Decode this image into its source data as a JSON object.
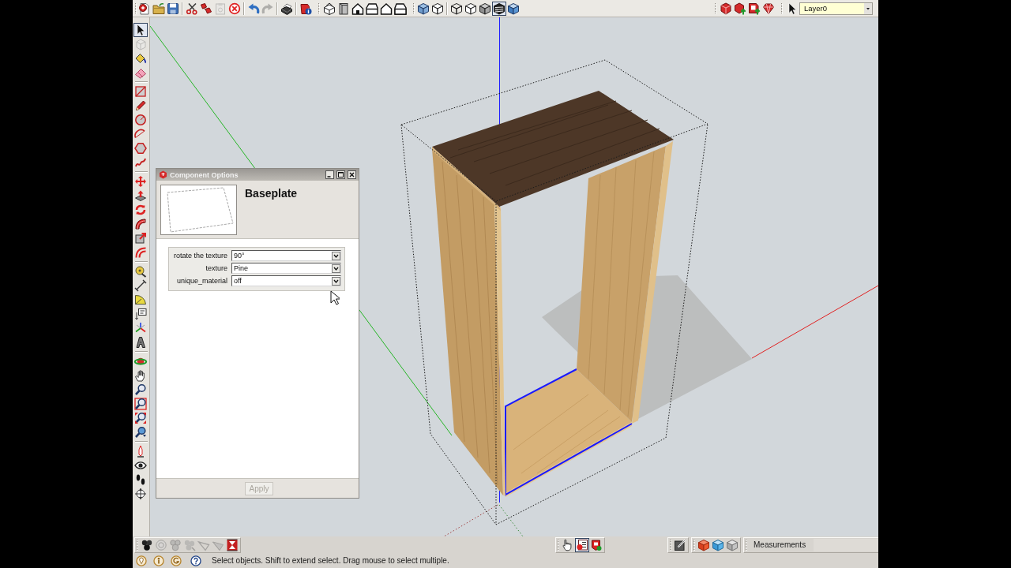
{
  "standard_toolbar": {
    "buttons": [
      {
        "disabled": false
      },
      {
        "disabled": false
      },
      {
        "disabled": false
      },
      {
        "disabled": false
      },
      {
        "disabled": false
      },
      {
        "disabled": true
      },
      {
        "disabled": false
      },
      {
        "disabled": false
      },
      {
        "disabled": true
      },
      {
        "disabled": false
      },
      {
        "disabled": false
      }
    ]
  },
  "style_toolbar": {
    "buttons": [
      {
        "selected": false
      },
      {
        "selected": false
      },
      {
        "selected": false
      },
      {
        "selected": false
      },
      {
        "selected": false
      },
      {
        "selected": true
      },
      {
        "selected": false
      }
    ]
  },
  "layers_toolbar": {
    "current_layer": "Layer0"
  },
  "tool_palette": {
    "groups": [
      {
        "tools": [
          {
            "selected": true,
            "disabled": false
          },
          {
            "selected": false,
            "disabled": true
          },
          {
            "selected": false,
            "disabled": false
          },
          {
            "selected": false,
            "disabled": false
          }
        ]
      },
      {
        "tools": [
          {
            "selected": false,
            "disabled": false
          },
          {
            "selected": false,
            "disabled": false
          },
          {
            "selected": false,
            "disabled": false
          },
          {
            "selected": false,
            "disabled": false
          },
          {
            "selected": false,
            "disabled": false
          },
          {
            "selected": false,
            "disabled": false
          }
        ]
      },
      {
        "tools": [
          {
            "selected": false,
            "disabled": false
          },
          {
            "selected": false,
            "disabled": false
          },
          {
            "selected": false,
            "disabled": false
          },
          {
            "selected": false,
            "disabled": false
          },
          {
            "selected": false,
            "disabled": false
          },
          {
            "selected": false,
            "disabled": false
          }
        ]
      },
      {
        "tools": [
          {
            "selected": false,
            "disabled": false
          },
          {
            "selected": false,
            "disabled": false
          },
          {
            "selected": false,
            "disabled": false
          },
          {
            "selected": false,
            "disabled": false
          },
          {
            "selected": false,
            "disabled": false
          },
          {
            "selected": false,
            "disabled": false
          }
        ]
      },
      {
        "tools": [
          {
            "selected": false,
            "disabled": false
          },
          {
            "selected": false,
            "disabled": false
          },
          {
            "selected": false,
            "disabled": false
          },
          {
            "selected": false,
            "disabled": false
          },
          {
            "selected": false,
            "disabled": false
          },
          {
            "selected": false,
            "disabled": false
          }
        ]
      },
      {
        "tools": [
          {
            "selected": false,
            "disabled": false
          },
          {
            "selected": false,
            "disabled": false
          },
          {
            "selected": false,
            "disabled": false
          },
          {
            "selected": false,
            "disabled": false
          }
        ]
      }
    ]
  },
  "dialog": {
    "title": "Component Options",
    "component_name": "Baseplate",
    "options": [
      {
        "label": "rotate the texture",
        "value": "90°"
      },
      {
        "label": "texture",
        "value": "Pine"
      },
      {
        "label": "unique_material",
        "value": "off"
      }
    ],
    "apply_button": {
      "label": "Apply",
      "disabled": true
    }
  },
  "bottom_toolbar": {
    "buttons": [
      {
        "disabled": false
      },
      {
        "disabled": true
      },
      {
        "disabled": true
      },
      {
        "disabled": true
      },
      {
        "disabled": true
      },
      {
        "disabled": true
      },
      {
        "disabled": false
      }
    ]
  },
  "dynamic_components_toolbar": {
    "buttons": [
      {
        "selected": false
      },
      {
        "selected": true
      },
      {
        "selected": false
      }
    ]
  },
  "measurements": {
    "label": "Measurements"
  },
  "status_bar": {
    "message": "Select objects. Shift to extend select. Drag mouse to select multiple."
  }
}
